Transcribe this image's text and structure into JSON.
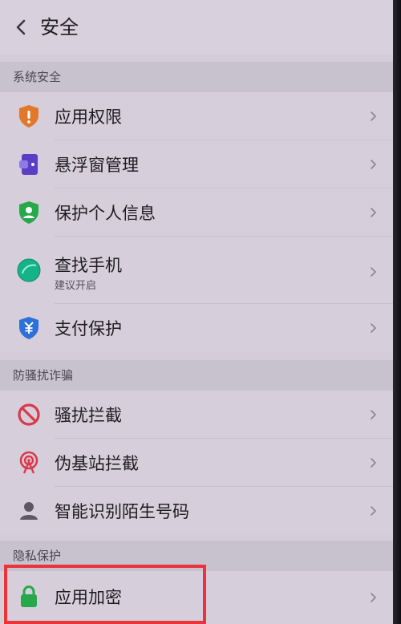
{
  "header": {
    "title": "安全"
  },
  "sections": [
    {
      "label": "系统安全",
      "items": [
        {
          "label": "应用权限",
          "icon": "shield-exclamation-icon"
        },
        {
          "label": "悬浮窗管理",
          "icon": "floating-window-icon"
        },
        {
          "label": "保护个人信息",
          "icon": "person-shield-icon"
        },
        {
          "label": "查找手机",
          "sub": "建议开启",
          "icon": "find-phone-icon"
        },
        {
          "label": "支付保护",
          "icon": "payment-shield-icon"
        }
      ]
    },
    {
      "label": "防骚扰诈骗",
      "items": [
        {
          "label": "骚扰拦截",
          "icon": "block-icon"
        },
        {
          "label": "伪基站拦截",
          "icon": "signal-tower-icon"
        },
        {
          "label": "智能识别陌生号码",
          "icon": "person-icon"
        }
      ]
    },
    {
      "label": "隐私保护",
      "items": [
        {
          "label": "应用加密",
          "icon": "lock-icon",
          "highlighted": true
        }
      ]
    }
  ],
  "colors": {
    "orange": "#e2782b",
    "purple": "#5a3fc6",
    "green": "#27a84b",
    "teal": "#14b38a",
    "blue": "#2f6fd8",
    "red": "#d93a4b",
    "gray": "#5c5866",
    "highlight": "#e8343a"
  }
}
